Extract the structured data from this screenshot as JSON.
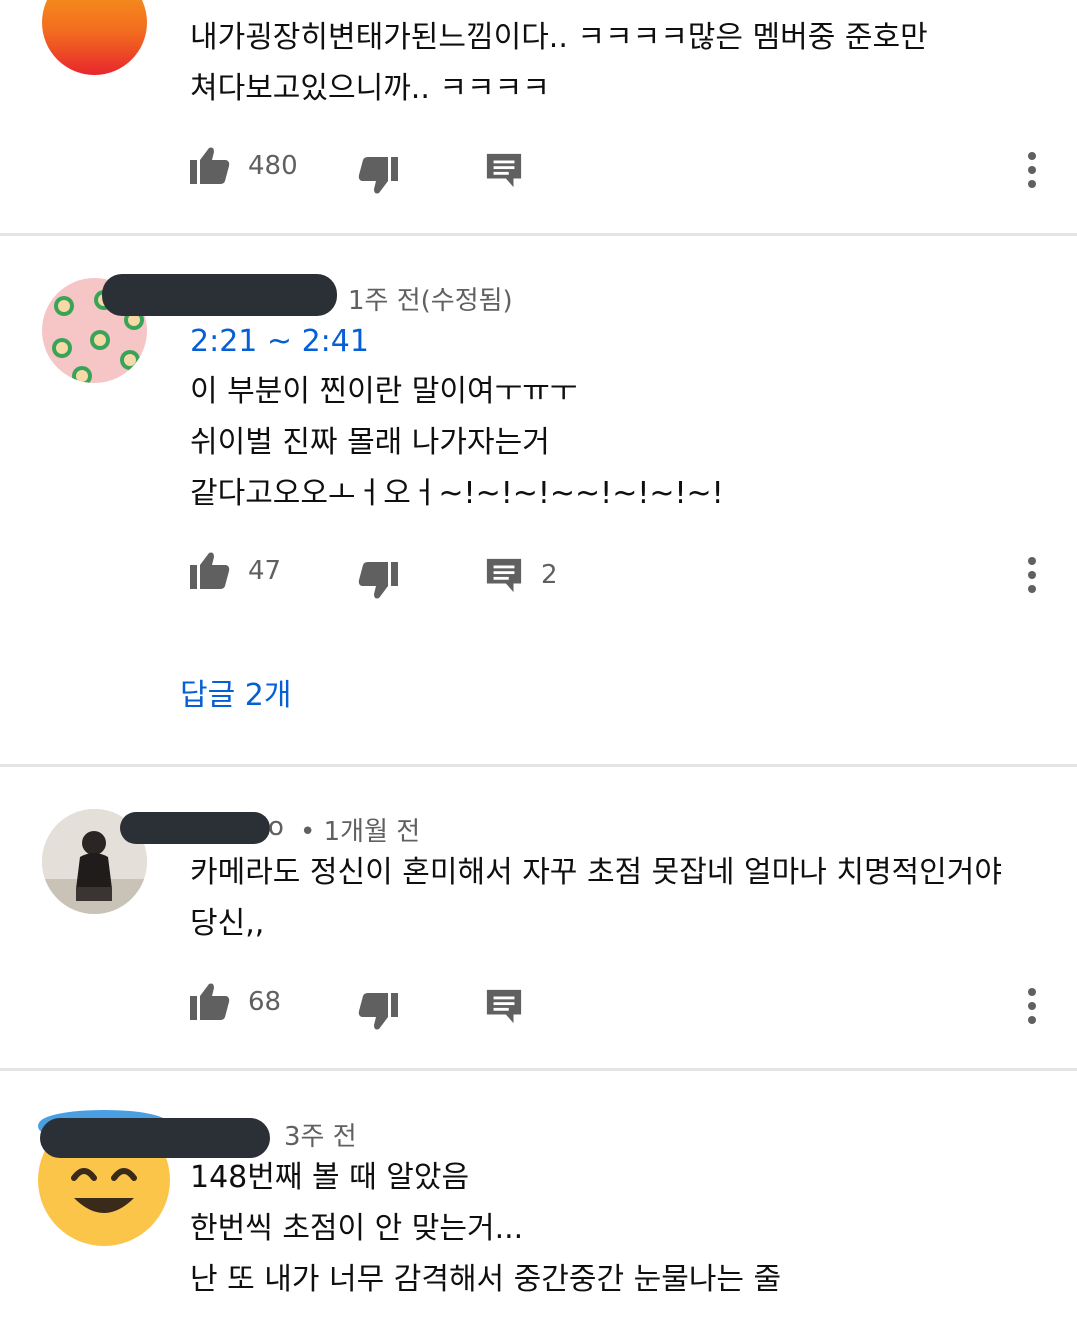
{
  "comments": [
    {
      "lines": [
        "내가굉장히변태가된느낌이다.. ㅋㅋㅋㅋ많은 멤버중 준호만",
        "쳐다보고있으니까.. ㅋㅋㅋㅋ"
      ],
      "likes": "480"
    },
    {
      "meta": "1주 전(수정됨)",
      "timestamp": "2:21 ~ 2:41",
      "lines": [
        "이 부분이 찐이란 말이여ㅜㅠㅜ",
        "쉬이벌 진짜 몰래 나가자는거",
        "같다고오오ㅗㅓ오ㅓ~!~!~!~~!~!~!~!"
      ],
      "likes": "47",
      "reply_count": "2",
      "replies_link": "답글 2개"
    },
    {
      "name_tail": "o",
      "meta": "• 1개월 전",
      "lines": [
        "카메라도 정신이 혼미해서 자꾸 초점 못잡네 얼마나 치명적인거야",
        "당신,,"
      ],
      "likes": "68"
    },
    {
      "meta": "3주 전",
      "lines": [
        "148번째 볼 때 알았음",
        "한번씩 초점이 안 맞는거...",
        "난 또 내가 너무 감격해서 중간중간 눈물나는 줄"
      ]
    }
  ],
  "icons": {
    "like": "thumb-up-icon",
    "dislike": "thumb-down-icon",
    "reply": "comment-icon",
    "more": "more-vert-icon"
  },
  "colors": {
    "link": "#065fd4",
    "meta": "#606060",
    "redaction": "#2b2f36"
  }
}
